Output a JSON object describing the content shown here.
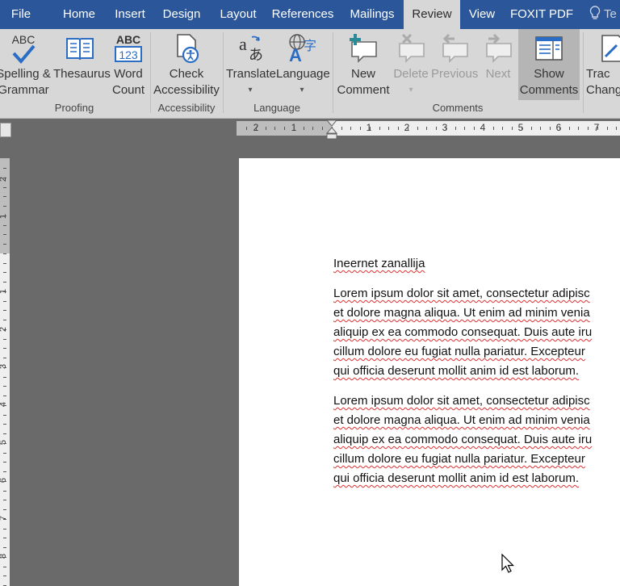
{
  "tabs": [
    "File",
    "Home",
    "Insert",
    "Design",
    "Layout",
    "References",
    "Mailings",
    "Review",
    "View",
    "FOXIT PDF"
  ],
  "active_tab": "Review",
  "tell_me": "Te",
  "ribbon": {
    "proofing": {
      "spelling_label_1": "Spelling &",
      "spelling_label_2": "Grammar",
      "spelling_icon_text": "ABC",
      "thesaurus_label": "Thesaurus",
      "wordcount_label_1": "Word",
      "wordcount_label_2": "Count",
      "wordcount_icon_top": "ABC",
      "wordcount_icon_bottom": "123",
      "group_label": "Proofing"
    },
    "accessibility": {
      "check_label_1": "Check",
      "check_label_2": "Accessibility",
      "group_label": "Accessibility"
    },
    "language": {
      "translate_label": "Translate",
      "language_label": "Language",
      "group_label": "Language"
    },
    "comments": {
      "new_label_1": "New",
      "new_label_2": "Comment",
      "delete_label": "Delete",
      "previous_label": "Previous",
      "next_label": "Next",
      "show_label_1": "Show",
      "show_label_2": "Comments",
      "group_label": "Comments"
    },
    "tracking": {
      "track_label_1": "Trac",
      "track_label_2": "Chang"
    }
  },
  "ruler": {
    "h_numbers": [
      "2",
      "1",
      "1",
      "2",
      "3",
      "4",
      "5",
      "6",
      "7"
    ],
    "v_numbers": [
      "2",
      "1",
      "1",
      "2",
      "3",
      "4",
      "5",
      "6",
      "7",
      "8"
    ]
  },
  "document": {
    "title": "Ineernet zanallija",
    "paragraph1": [
      "Lorem ipsum dolor sit amet, consectetur adipisc",
      "et dolore magna aliqua. Ut enim ad minim venia",
      "aliquip ex ea commodo consequat. Duis aute iru",
      "cillum dolore eu fugiat nulla pariatur. Excepteur",
      "qui officia deserunt mollit anim id est laborum."
    ],
    "paragraph2": [
      "Lorem ipsum dolor sit amet, consectetur adipisc",
      "et dolore magna aliqua. Ut enim ad minim venia",
      "aliquip ex ea commodo consequat. Duis aute iru",
      "cillum dolore eu fugiat nulla pariatur. Excepteur",
      "qui officia deserunt mollit anim id est laborum."
    ]
  },
  "colors": {
    "accent": "#2b579a",
    "ribbon_bg": "#d7d7d7",
    "workspace_bg": "#6a6a6a",
    "spellcheck_squiggle": "#e03030"
  }
}
